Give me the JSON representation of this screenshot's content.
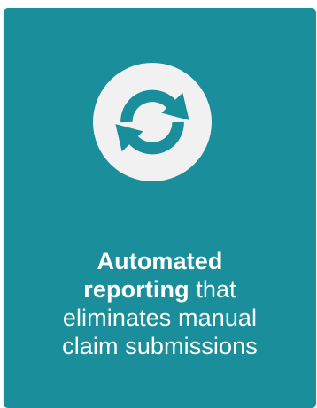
{
  "card": {
    "background_color": "#1b8e9b",
    "icon": {
      "name": "sync-icon",
      "color": "#1b8e9b",
      "background_color": "#f1f1f1"
    },
    "caption": {
      "bold_line_1": "Automated",
      "bold_line_2": "reporting",
      "rest_line_2": " that",
      "line_3": "eliminates manual",
      "line_4": "claim submissions"
    }
  }
}
